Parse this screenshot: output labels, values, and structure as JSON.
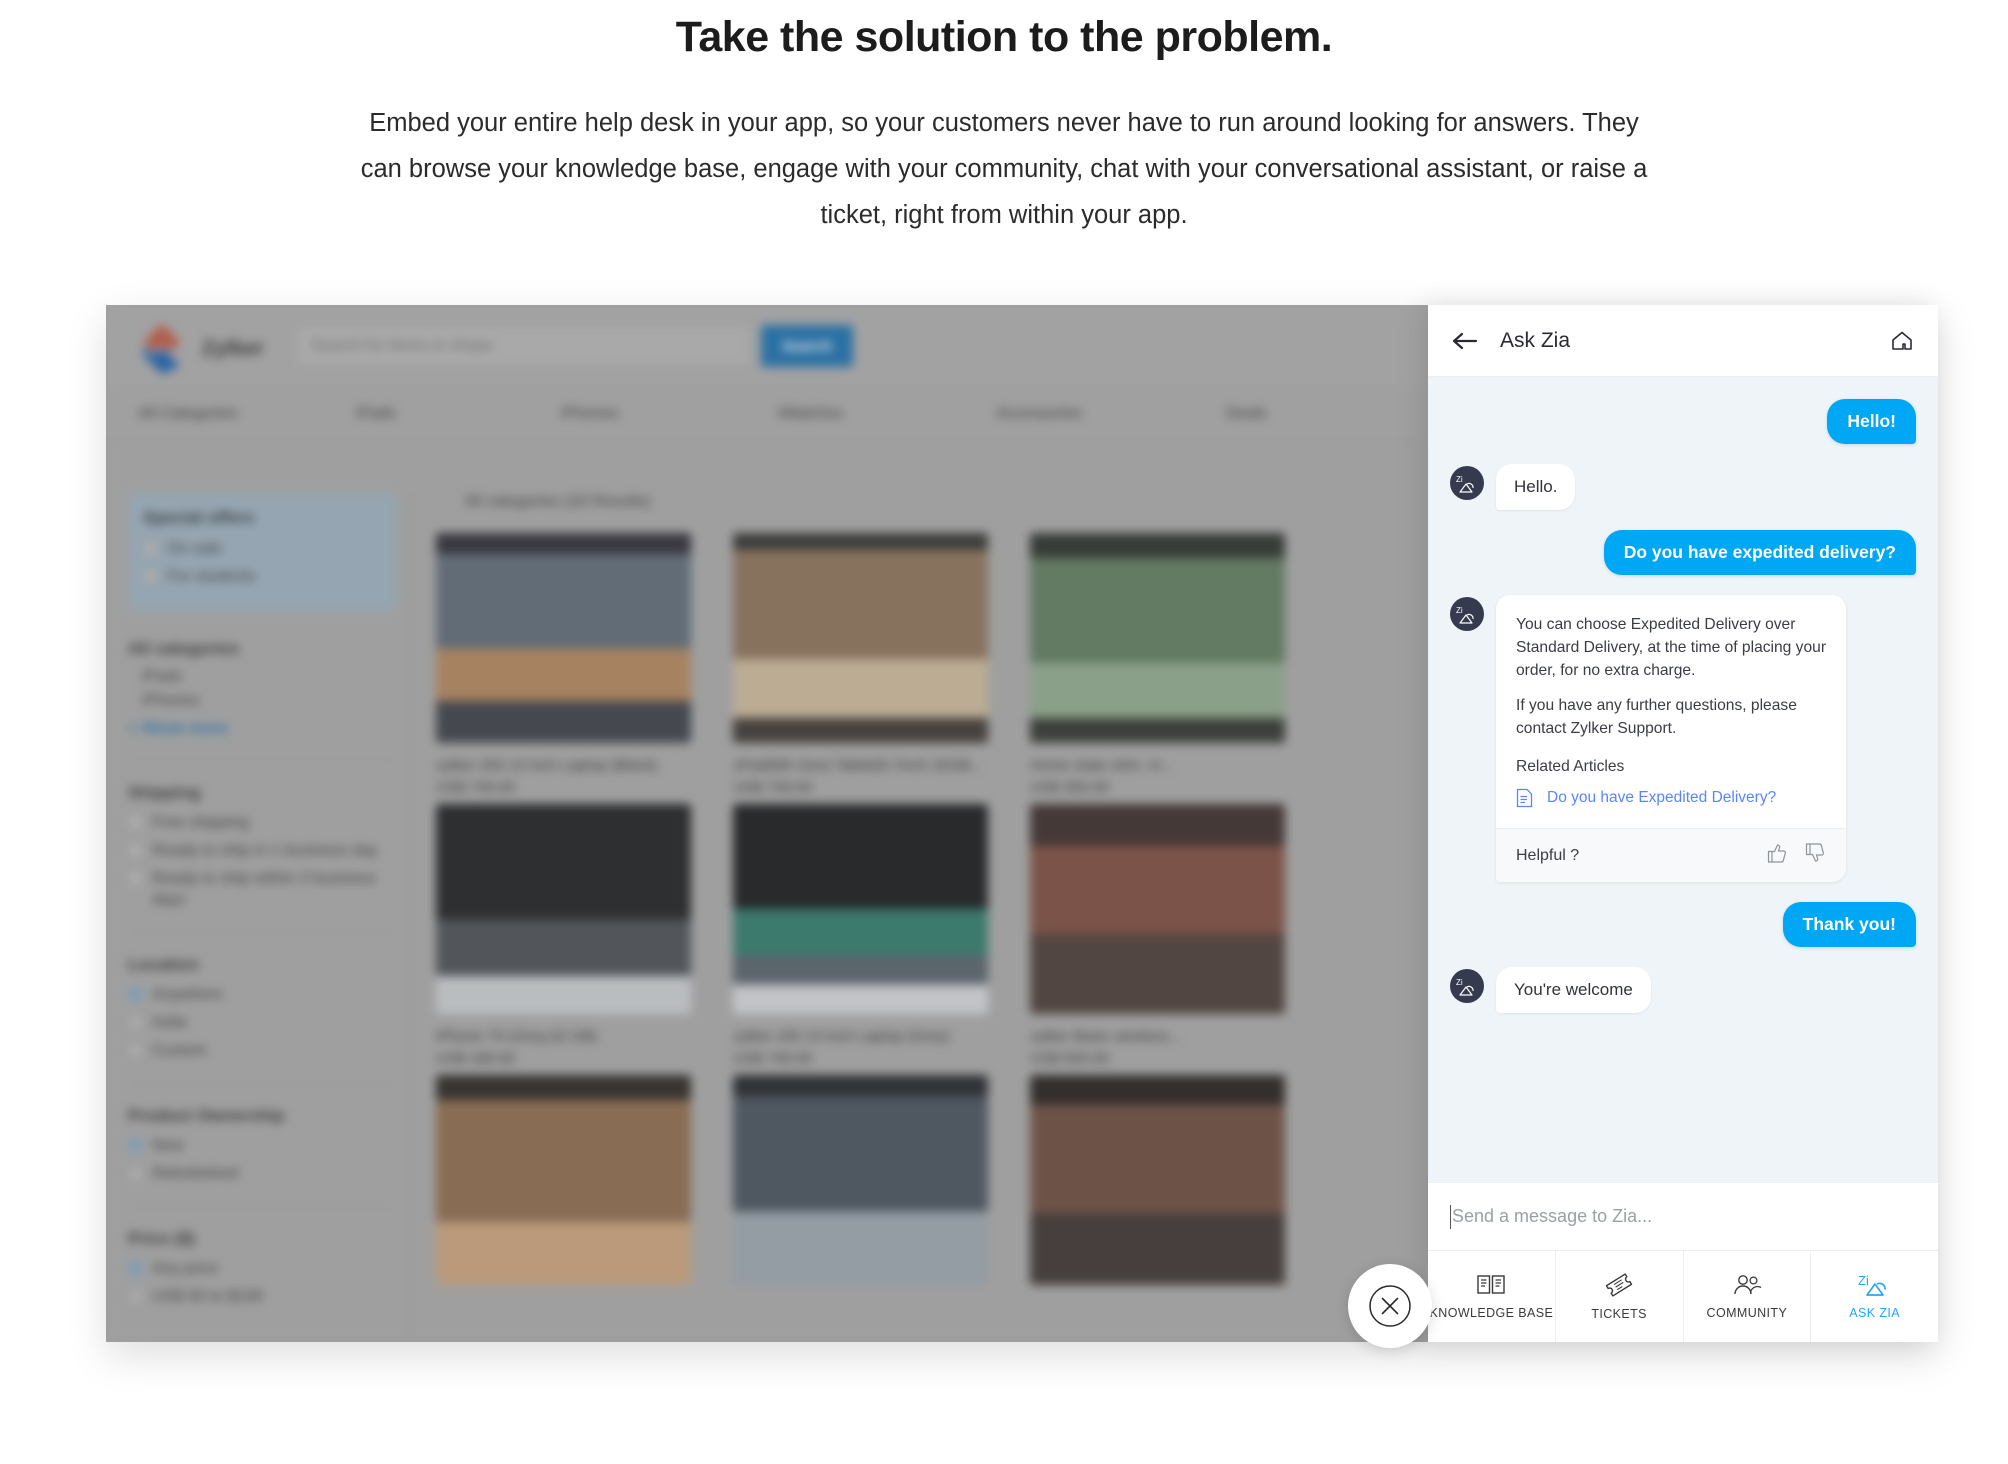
{
  "hero": {
    "headline": "Take the solution to the problem.",
    "body": "Embed your entire help desk in your app, so your customers never have to run around looking for answers. They can browse your knowledge base, engage with your community, chat with your conversational assistant, or raise a ticket, right from within your app."
  },
  "storefront": {
    "brand": "Zylker",
    "search_placeholder": "Search for items or shops",
    "search_button": "Search",
    "nav": [
      "All Categories",
      "iPads",
      "iPhones",
      "iWatches",
      "Accessories",
      "Deals"
    ],
    "results_text": "All categories (20 Results)",
    "facets": {
      "special_offers": {
        "title": "Special offers",
        "options": [
          "On sale",
          "For students"
        ]
      },
      "all_categories": {
        "title": "All categories",
        "items": [
          "iPads",
          "iPhones"
        ],
        "show_more": "+ Show more"
      },
      "shipping": {
        "title": "Shipping",
        "options": [
          "Free shipping",
          "Ready to ship in 1 business day",
          "Ready to ship within 3 business days"
        ]
      },
      "location": {
        "title": "Location",
        "options": [
          "Anywhere",
          "India",
          "Custom"
        ],
        "selected": "Anywhere"
      },
      "ownership": {
        "title": "Product Ownership",
        "options": [
          "New",
          "Refurbished"
        ],
        "selected": "New"
      },
      "price": {
        "title": "Price ($)",
        "options": [
          "Any price",
          "US$ 50 to $100"
        ],
        "selected": "Any price"
      }
    },
    "products": [
      {
        "name": "zylker 250 13 inch Laptop (Black)",
        "price": "US$ 749.00"
      },
      {
        "name": "zPad(6th Gen) Tablet(9.7inch 32GB...",
        "price": "US$ 749.00"
      },
      {
        "name": "Home state shirt, Vi...",
        "price": "US$ 350.00"
      },
      {
        "name": "iPhone 7S (Grey,32 GB)",
        "price": "US$ 189.00"
      },
      {
        "name": "zylker z50 13 inch Laptop (Grey)",
        "price": "US$ 749.00"
      },
      {
        "name": "zylker Basic wireless...",
        "price": "US$ 500.00"
      }
    ]
  },
  "widget": {
    "header": {
      "title": "Ask Zia",
      "back_icon": "back-arrow-icon",
      "home_icon": "home-icon"
    },
    "messages": [
      {
        "from": "user",
        "text": "Hello!"
      },
      {
        "from": "bot",
        "text": "Hello."
      },
      {
        "from": "user",
        "text": "Do you have expedited delivery?"
      },
      {
        "from": "bot_card",
        "paragraphs": [
          "You can choose Expedited Delivery over Standard Delivery, at the time of placing your order, for no extra charge.",
          "If you have any further questions, please contact Zylker Support."
        ],
        "related_title": "Related Articles",
        "related_links": [
          "Do you have Expedited Delivery?"
        ],
        "feedback_label": "Helpful ?"
      },
      {
        "from": "user",
        "text": "Thank you!"
      },
      {
        "from": "bot",
        "text": "You're welcome"
      }
    ],
    "composer": {
      "placeholder": "Send a message to Zia...",
      "value": ""
    },
    "tabs": [
      {
        "label": "KNOWLEDGE BASE",
        "icon": "book-icon",
        "active": false
      },
      {
        "label": "TICKETS",
        "icon": "ticket-icon",
        "active": false
      },
      {
        "label": "COMMUNITY",
        "icon": "people-icon",
        "active": false
      },
      {
        "label": "ASK ZIA",
        "icon": "zia-logo-icon",
        "active": true
      }
    ],
    "close_button_icon": "close-circle-icon"
  },
  "colors": {
    "accent_blue": "#00a7f5",
    "link_blue": "#5b86f7",
    "tab_active": "#24a7f2",
    "avatar_navy": "#353a4e",
    "chat_bg": "#eef4f7",
    "brand_red": "#c0553d",
    "brand_blue": "#1a5fae"
  }
}
